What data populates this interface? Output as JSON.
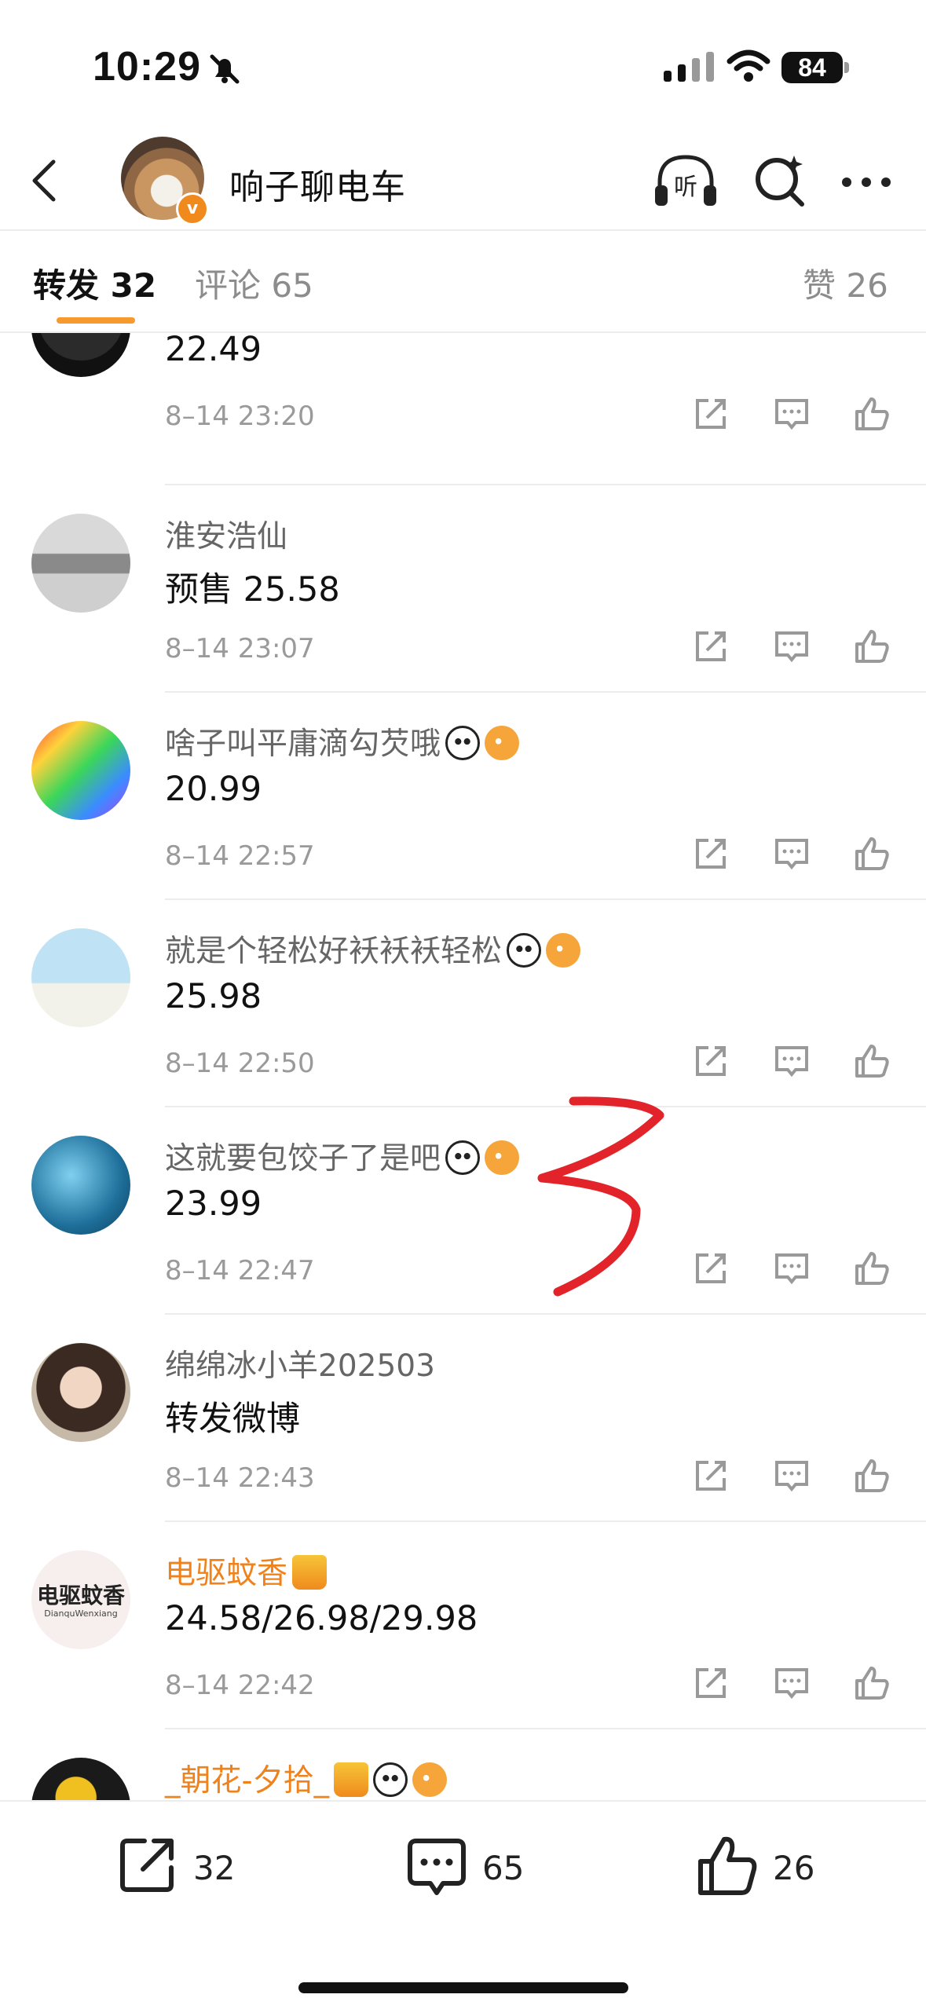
{
  "status_bar": {
    "time": "10:29",
    "battery": "84"
  },
  "header": {
    "title": "响子聊电车"
  },
  "tabs": {
    "repost": "转发 32",
    "comment": "评论 65",
    "like": "赞 26"
  },
  "items": [
    {
      "name": "",
      "text": "22.49",
      "time": "8–14 23:20"
    },
    {
      "name": "淮安浩仙",
      "text": "预售 25.58",
      "time": "8–14 23:07"
    },
    {
      "name": "啥子叫平庸滴勾芡哦",
      "text": "20.99",
      "time": "8–14 22:57"
    },
    {
      "name": "就是个轻松好袄袄袄轻松",
      "text": "25.98",
      "time": "8–14 22:50"
    },
    {
      "name": "这就要包饺子了是吧",
      "text": "23.99",
      "time": "8–14 22:47"
    },
    {
      "name": "绵绵冰小羊202503",
      "text": "转发微博",
      "time": "8–14 22:43"
    },
    {
      "name": "电驱蚊香",
      "text": "24.58/26.98/29.98",
      "time": "8–14 22:42"
    },
    {
      "name": "_朝花-夕拾_",
      "text": "",
      "time": ""
    }
  ],
  "avatar_label": {
    "line1": "电驱蚊香",
    "line2": "DianquWenxiang"
  },
  "bottom_bar": {
    "repost_count": "32",
    "comment_count": "65",
    "like_count": "26"
  },
  "colors": {
    "accent": "#f79a2e",
    "orange_name": "#f0821c",
    "annotation": "#e3232a"
  }
}
